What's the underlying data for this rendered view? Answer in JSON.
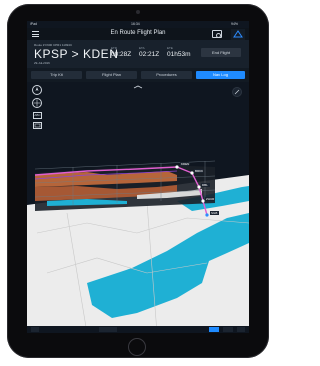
{
  "status": {
    "carrier": "iPad",
    "time": "16:34",
    "battery": "94%"
  },
  "nav": {
    "title": "En Route Flight Plan"
  },
  "flight": {
    "route_small": "Route # F900  CPR1 11994C",
    "origin": "KPSP",
    "separator": ">",
    "destination": "KDEN",
    "date": "29-Jul-2016",
    "times": [
      {
        "label": "ETD",
        "value": "00:28Z"
      },
      {
        "label": "ETA",
        "value": "02:21Z"
      },
      {
        "label": "ETE",
        "value": "01h53m"
      }
    ],
    "end_flight_label": "End Flight"
  },
  "tabs": [
    {
      "label": "Trip Kit",
      "active": false
    },
    {
      "label": "Flight Plan",
      "active": false
    },
    {
      "label": "Procedures",
      "active": false
    },
    {
      "label": "Nav Log",
      "active": true
    }
  ],
  "map": {
    "controls": {
      "airport_label": "ABC"
    },
    "waypoint_labels": [
      "KDEN",
      "BRKK",
      "DBL",
      "ZHUR",
      "SGB"
    ],
    "colors": {
      "water": "#1fb0d4",
      "land": "#ededed",
      "route": "#e05fd0",
      "terrain": "#b5653a",
      "accent": "#1f8bff"
    }
  }
}
